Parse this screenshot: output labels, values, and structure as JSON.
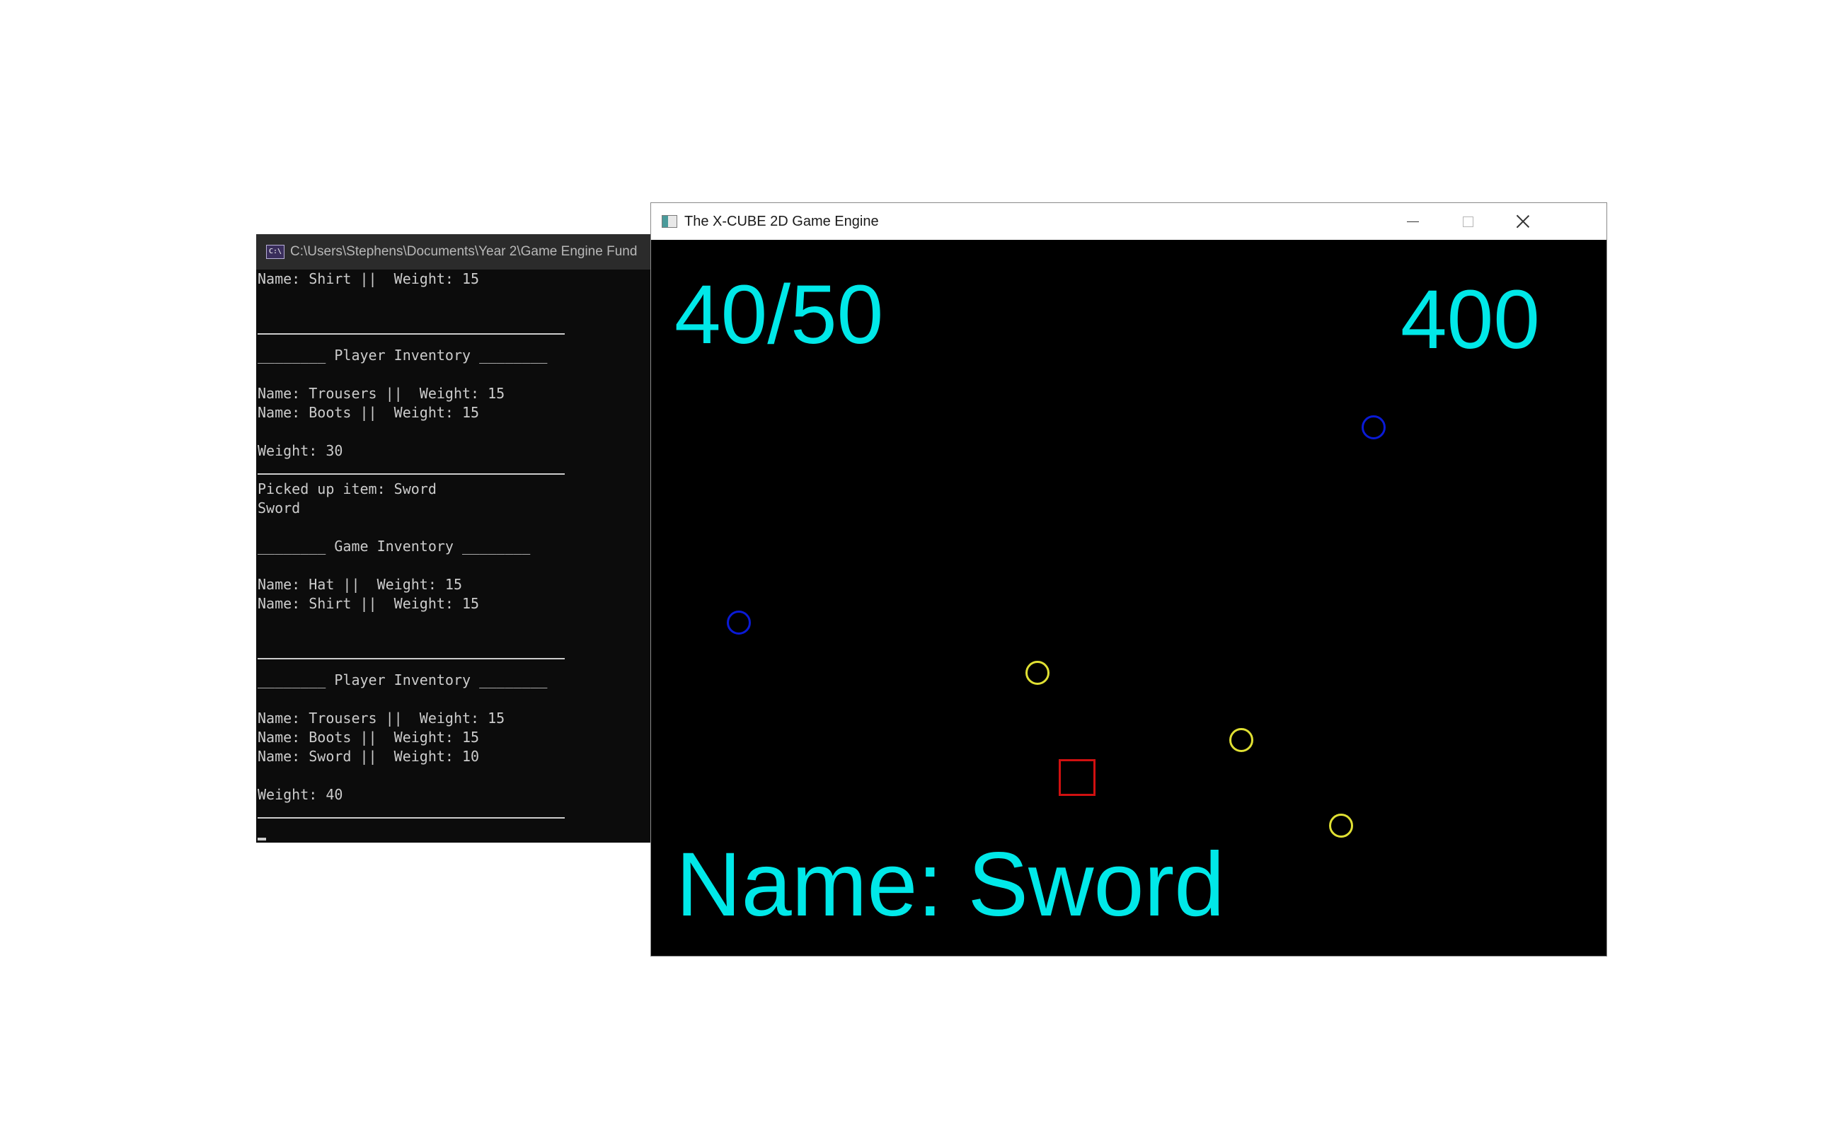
{
  "console": {
    "title": "C:\\Users\\Stephens\\Documents\\Year 2\\Game Engine Fund",
    "icon": "console-app-icon",
    "icon_glyph": "C:\\",
    "lines": [
      "Name: Shirt ||  Weight: 15",
      "",
      "",
      "________ Player Inventory ________",
      "",
      "Name: Trousers ||  Weight: 15",
      "Name: Boots ||  Weight: 15",
      "",
      "Weight: 30",
      "",
      "Picked up item: Sword",
      "Sword",
      "",
      "________ Game Inventory ________",
      "",
      "Name: Hat ||  Weight: 15",
      "Name: Shirt ||  Weight: 15",
      "",
      "",
      "________ Player Inventory ________",
      "",
      "Name: Trousers ||  Weight: 15",
      "Name: Boots ||  Weight: 15",
      "Name: Sword ||  Weight: 10",
      "",
      "Weight: 40",
      ""
    ]
  },
  "game_window": {
    "title": "The X-CUBE 2D Game Engine",
    "icon": "app-window-icon",
    "controls": {
      "minimize": "minimize-icon",
      "maximize": "maximize-icon",
      "close": "close-icon"
    },
    "hud": {
      "weight": "40/50",
      "score": "400",
      "item_name": "Name: Sword"
    },
    "colors": {
      "hud_text": "#00e8e8",
      "blue_circle": "#0a1ad6",
      "yellow_circle": "#e0e033",
      "player_square": "#d01010",
      "background": "#000000"
    }
  }
}
